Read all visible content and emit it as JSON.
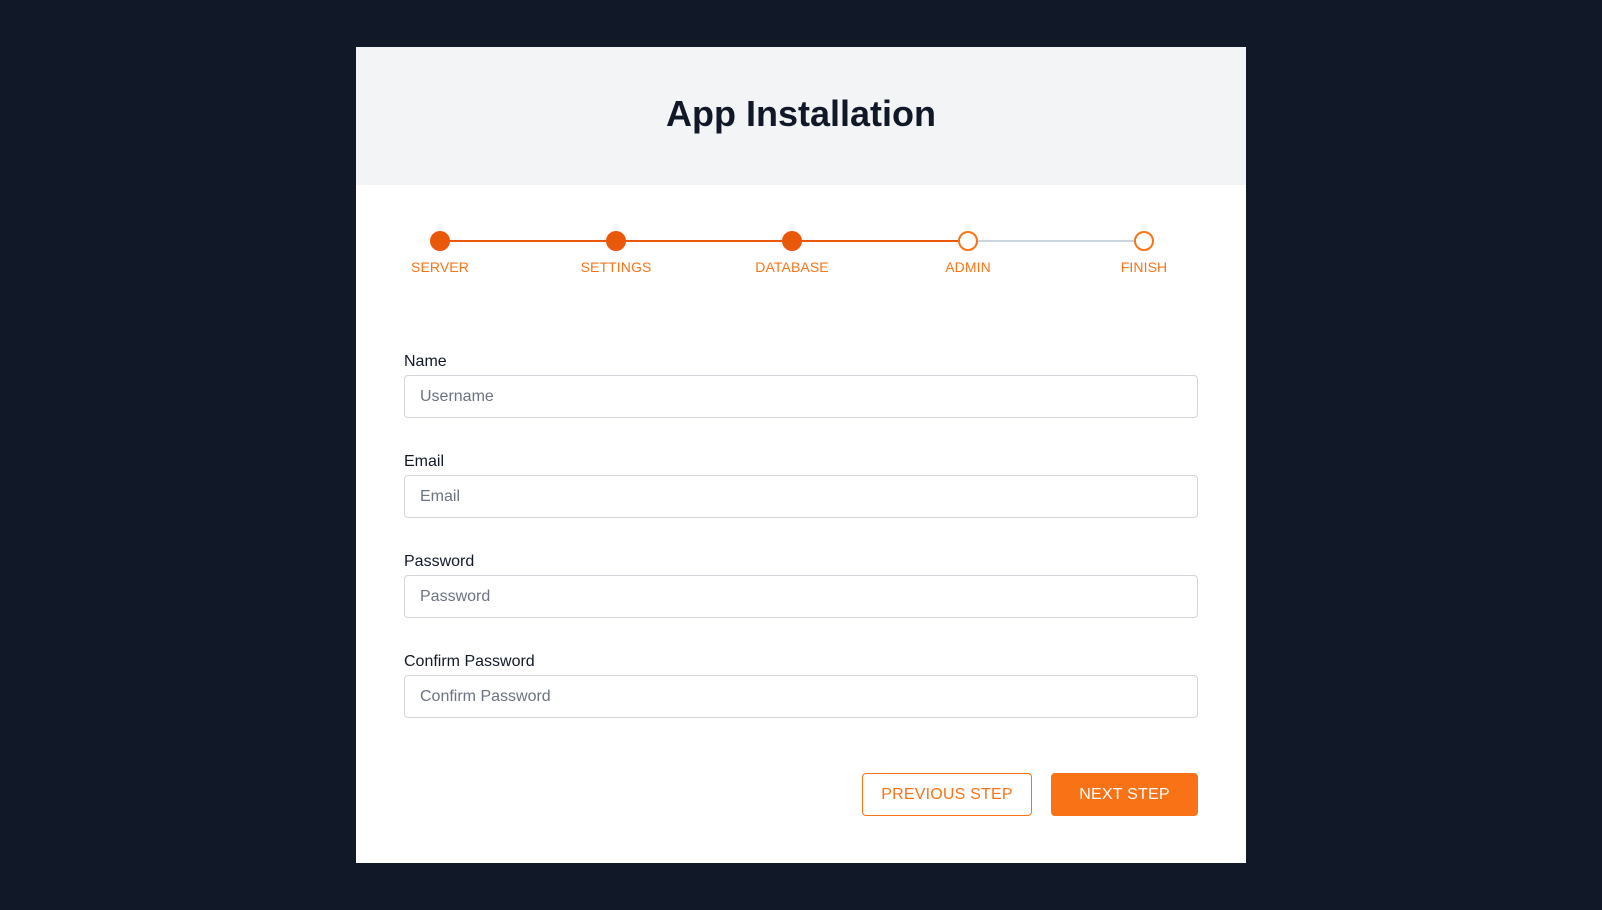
{
  "header": {
    "title": "App Installation"
  },
  "stepper": {
    "steps": [
      {
        "label": "SERVER",
        "completed": true
      },
      {
        "label": "SETTINGS",
        "completed": true
      },
      {
        "label": "DATABASE",
        "completed": true
      },
      {
        "label": "ADMIN",
        "completed": false
      },
      {
        "label": "FINISH",
        "completed": false
      }
    ]
  },
  "form": {
    "fields": [
      {
        "label": "Name",
        "placeholder": "Username",
        "value": ""
      },
      {
        "label": "Email",
        "placeholder": "Email",
        "value": ""
      },
      {
        "label": "Password",
        "placeholder": "Password",
        "value": ""
      },
      {
        "label": "Confirm Password",
        "placeholder": "Confirm Password",
        "value": ""
      }
    ]
  },
  "actions": {
    "previous_label": "PREVIOUS STEP",
    "next_label": "NEXT STEP"
  },
  "colors": {
    "page_background": "#111827",
    "accent": "#f97316",
    "accent_dark": "#ea580c",
    "line_completed": "#ea580c",
    "line_pending": "#cbd5e1",
    "header_background": "#f3f4f6"
  }
}
